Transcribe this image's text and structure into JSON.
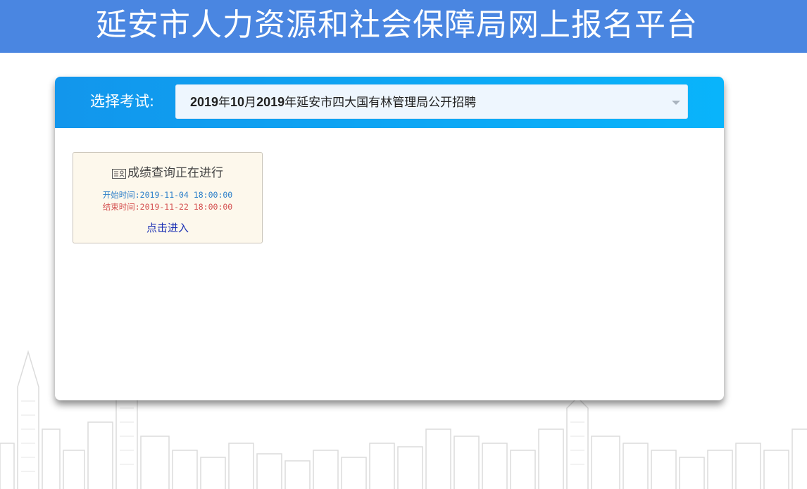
{
  "header": {
    "title": "延安市人力资源和社会保障局网上报名平台"
  },
  "exam_select": {
    "label": "选择考试:",
    "selected": [
      {
        "text": "2019",
        "bold": true
      },
      {
        "text": "年",
        "bold": false
      },
      {
        "text": "10",
        "bold": true
      },
      {
        "text": "月",
        "bold": false
      },
      {
        "text": "2019",
        "bold": true
      },
      {
        "text": "年延安市四大国有林管理局公开招聘",
        "bold": false
      }
    ]
  },
  "exam_card": {
    "icon": "id-card-icon",
    "title": "成绩查询正在进行",
    "start_time": "开始时间:2019-11-04 18:00:00",
    "end_time": "结束时间:2019-11-22 18:00:00",
    "link": "点击进入"
  },
  "colors": {
    "header_bg": "#4a86e1",
    "panel_head_start": "#1296ec",
    "panel_head_end": "#09b4fb",
    "card_bg": "#fdf8ec",
    "start_time": "#2b7ec9",
    "end_time": "#d45050",
    "link": "#1a2fb4"
  }
}
